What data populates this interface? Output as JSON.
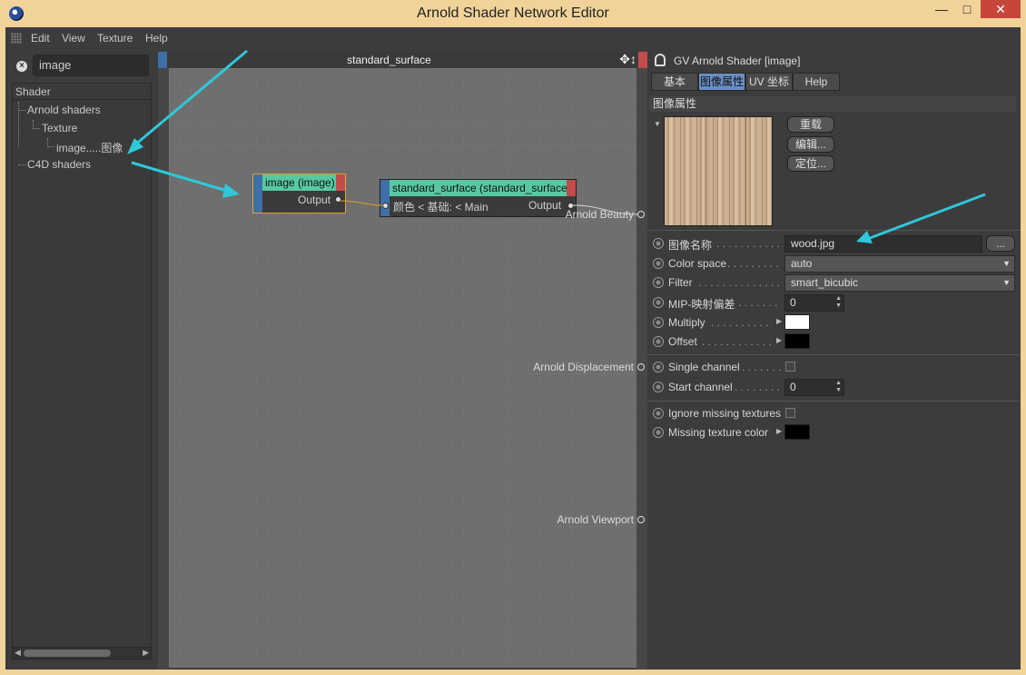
{
  "window": {
    "title": "Arnold Shader Network Editor",
    "min": "—",
    "max": "□",
    "close": "✕"
  },
  "menu": [
    "Edit",
    "View",
    "Texture",
    "Help"
  ],
  "search": {
    "value": "image"
  },
  "tree": {
    "header": "Shader",
    "items": [
      "Arnold shaders",
      "Texture",
      "image.....图像",
      "C4D shaders"
    ]
  },
  "canvas": {
    "title": "standard_surface",
    "nodes": {
      "image": {
        "title": "image (image)",
        "output": "Output"
      },
      "standard_surface": {
        "title": "standard_surface (standard_surface)",
        "input": "颜色 < 基础: < Main",
        "output": "Output"
      }
    },
    "outputs": [
      "Arnold Beauty",
      "Arnold Displacement",
      "Arnold Viewport"
    ]
  },
  "attrs": {
    "header": "GV Arnold Shader [image]",
    "tabs": [
      "基本",
      "图像属性",
      "UV 坐标",
      "Help"
    ],
    "active_tab": "图像属性",
    "section": "图像属性",
    "buttons": [
      "重载",
      "编辑...",
      "定位..."
    ],
    "rows": {
      "filename": {
        "label": "图像名称",
        "dots": ". . . . . . . . . . . .",
        "value": "wood.jpg",
        "browse": "..."
      },
      "colorspace": {
        "label": "Color space",
        "dots": ". . . . . . . . . .",
        "value": "auto"
      },
      "filter": {
        "label": "Filter",
        "dots": ". . . . . . . . . . . . . . .",
        "value": "smart_bicubic"
      },
      "mip": {
        "label": "MIP-映射偏差",
        "dots": ". . . . . . . .",
        "value": "0"
      },
      "multiply": {
        "label": "Multiply",
        "dots": ". . . . . . . . . . .",
        "color": "#ffffff"
      },
      "offset": {
        "label": "Offset",
        "dots": ". . . . . . . . . . . . .",
        "color": "#000000"
      },
      "single_channel": {
        "label": "Single channel",
        "dots": ". . . . . . ."
      },
      "start_channel": {
        "label": "Start channel",
        "dots": ". . . . . . . . .",
        "value": "0"
      },
      "ignore_missing": {
        "label": "Ignore missing textures"
      },
      "missing_color": {
        "label": "Missing texture color",
        "color": "#000000"
      }
    }
  },
  "colors": {
    "accent_tab": "#6a8fc4",
    "node_header": "#58c8a0",
    "node_selected_border": "#e0a030",
    "arrow": "#2ec8d8"
  }
}
